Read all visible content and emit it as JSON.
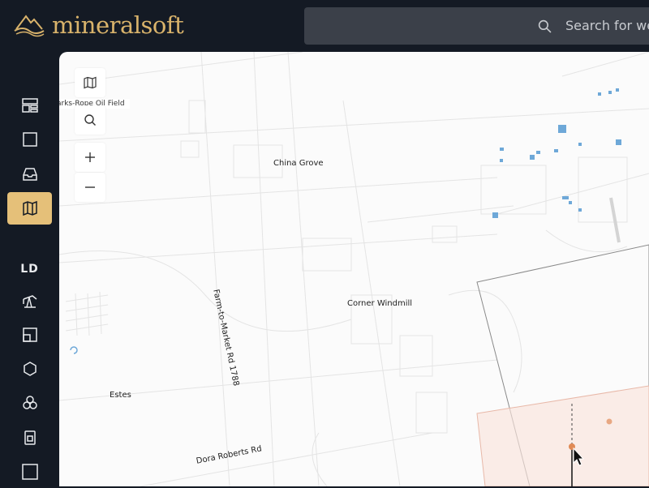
{
  "app": {
    "brand_name": "mineralsoft"
  },
  "header": {
    "search_placeholder": "Search for we"
  },
  "sidebar": {
    "items": [
      {
        "name": "dashboard",
        "icon": "dashboard-icon"
      },
      {
        "name": "square",
        "icon": "square-icon"
      },
      {
        "name": "inbox",
        "icon": "inbox-icon"
      },
      {
        "name": "map",
        "icon": "map-icon",
        "active": true
      },
      {
        "name": "ld",
        "label": "LD"
      },
      {
        "name": "oil-well",
        "icon": "oil-pump-icon"
      },
      {
        "name": "tracts",
        "icon": "tract-icon"
      },
      {
        "name": "hexagon",
        "icon": "hexagon-icon"
      },
      {
        "name": "clusters",
        "icon": "circles-icon"
      },
      {
        "name": "document",
        "icon": "document-icon"
      },
      {
        "name": "square-outline",
        "icon": "square-outline-icon"
      }
    ]
  },
  "map": {
    "field_label": "arks-Rope Oil Field",
    "labels": {
      "china_grove": "China Grove",
      "farm_road": "Farm-to-Market Rd 1788",
      "corner_windmill": "Corner Windmill",
      "estes": "Estes",
      "dora_roberts": "Dora Roberts Rd"
    },
    "controls": [
      "map-layers-icon",
      "search-icon",
      "zoom-in-icon",
      "zoom-out-icon"
    ]
  },
  "colors": {
    "accent": "#e5c079",
    "brand_text": "#d9b36b",
    "sidebar_bg": "#141a24",
    "well_blue": "#6ea8d8",
    "selection_fill": "#f9e4dc",
    "point_orange": "#e08a55"
  }
}
